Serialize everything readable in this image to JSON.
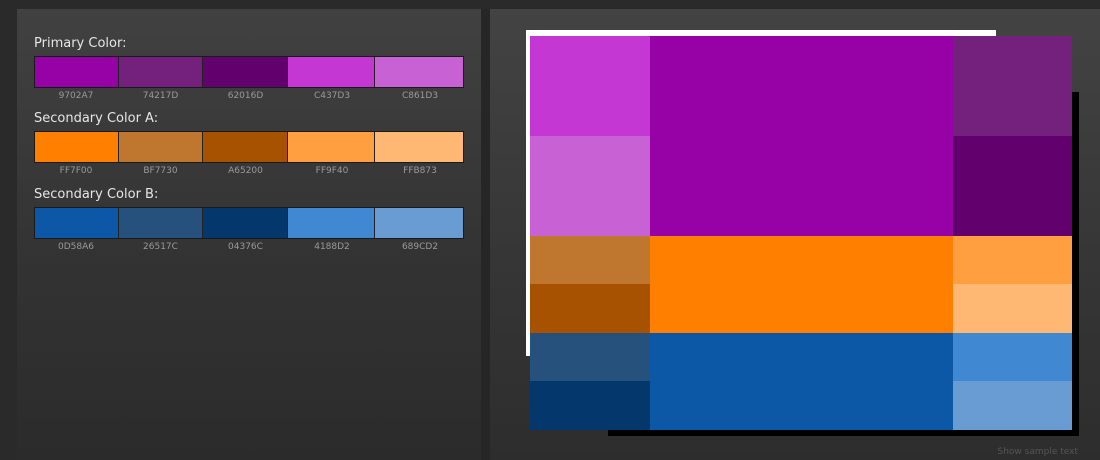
{
  "groups": [
    {
      "title": "Primary Color:",
      "swatches": [
        {
          "hex": "9702A7",
          "color": "#9702A7"
        },
        {
          "hex": "74217D",
          "color": "#74217D"
        },
        {
          "hex": "62016D",
          "color": "#62016D"
        },
        {
          "hex": "C437D3",
          "color": "#C437D3"
        },
        {
          "hex": "C861D3",
          "color": "#C861D3"
        }
      ]
    },
    {
      "title": "Secondary Color A:",
      "swatches": [
        {
          "hex": "FF7F00",
          "color": "#FF7F00"
        },
        {
          "hex": "BF7730",
          "color": "#BF7730"
        },
        {
          "hex": "A65200",
          "color": "#A65200"
        },
        {
          "hex": "FF9F40",
          "color": "#FF9F40"
        },
        {
          "hex": "FFB873",
          "color": "#FFB873"
        }
      ]
    },
    {
      "title": "Secondary Color B:",
      "swatches": [
        {
          "hex": "0D58A6",
          "color": "#0D58A6"
        },
        {
          "hex": "26517C",
          "color": "#26517C"
        },
        {
          "hex": "04376C",
          "color": "#04376C"
        },
        {
          "hex": "4188D2",
          "color": "#4188D2"
        },
        {
          "hex": "689CD2",
          "color": "#689CD2"
        }
      ]
    }
  ],
  "preview": {
    "cells": [
      {
        "color": "#C437D3"
      },
      {
        "color": "#9702A7"
      },
      {
        "color": "#74217D"
      },
      {
        "color": "#C861D3"
      },
      {
        "color": "#62016D"
      },
      {
        "color": "#BF7730"
      },
      {
        "color": "#FF7F00"
      },
      {
        "color": "#FF9F40"
      },
      {
        "color": "#A65200"
      },
      {
        "color": "#FFB873"
      },
      {
        "color": "#26517C"
      },
      {
        "color": "#0D58A6"
      },
      {
        "color": "#4188D2"
      },
      {
        "color": "#04376C"
      },
      {
        "color": "#689CD2"
      }
    ]
  },
  "sample_text_label": "Show sample text"
}
